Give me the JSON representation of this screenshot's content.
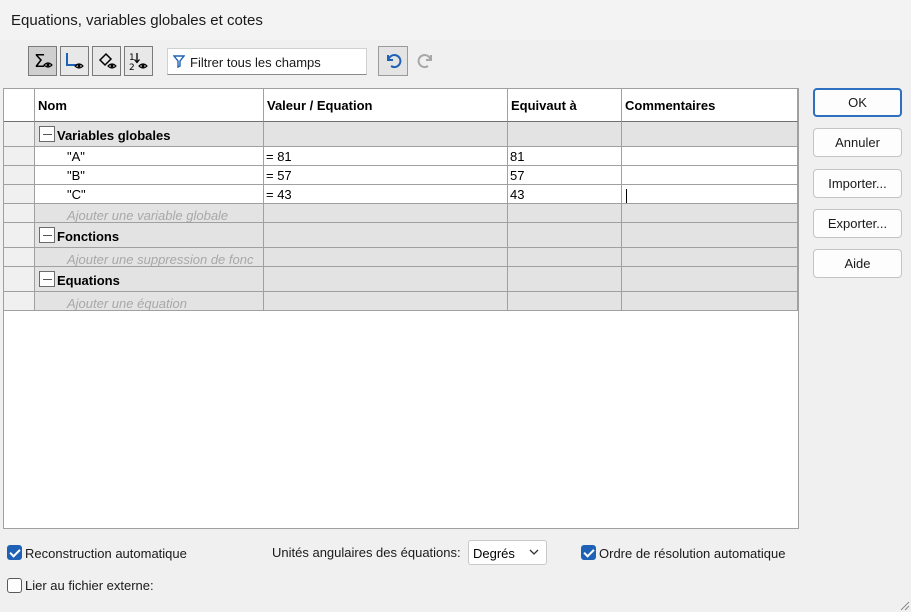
{
  "window": {
    "title": "Equations, variables globales et cotes"
  },
  "toolbar": {
    "buttons": [
      {
        "name": "equation-view-icon"
      },
      {
        "name": "sketch-equation-view-icon"
      },
      {
        "name": "dimension-view-icon"
      },
      {
        "name": "ordered-view-icon"
      }
    ],
    "filter_placeholder": "Filtrer tous les champs",
    "undo_icon": "undo-icon",
    "redo_icon": "redo-icon"
  },
  "table": {
    "headers": [
      "Nom",
      "Valeur / Equation",
      "Equivaut à",
      "Commentaires"
    ],
    "groups": {
      "global_vars": {
        "label": "Variables globales",
        "rows": [
          {
            "name": "\"A\"",
            "value": "= 81",
            "equals": "81",
            "comment": ""
          },
          {
            "name": "\"B\"",
            "value": "= 57",
            "equals": "57",
            "comment": ""
          },
          {
            "name": "\"C\"",
            "value": "= 43",
            "equals": "43",
            "comment": ""
          }
        ],
        "add_label": "Ajouter une variable globale"
      },
      "functions": {
        "label": "Fonctions",
        "add_label": "Ajouter une suppression de fonc"
      },
      "equations": {
        "label": "Equations",
        "add_label": "Ajouter une équation"
      }
    }
  },
  "side_buttons": {
    "ok": "OK",
    "cancel": "Annuler",
    "import": "Importer...",
    "export": "Exporter...",
    "help": "Aide"
  },
  "footer": {
    "auto_rebuild": {
      "label": "Reconstruction automatique",
      "checked": true
    },
    "angular_units_label": "Unités angulaires des équations:",
    "angular_units_value": "Degrés",
    "auto_solve_order": {
      "label": "Ordre de résolution automatique",
      "checked": true
    },
    "link_external": {
      "label": "Lier au fichier externe:",
      "checked": false
    }
  },
  "colors": {
    "accent": "#1f62b5",
    "grid_gray": "#e3e3e3"
  }
}
